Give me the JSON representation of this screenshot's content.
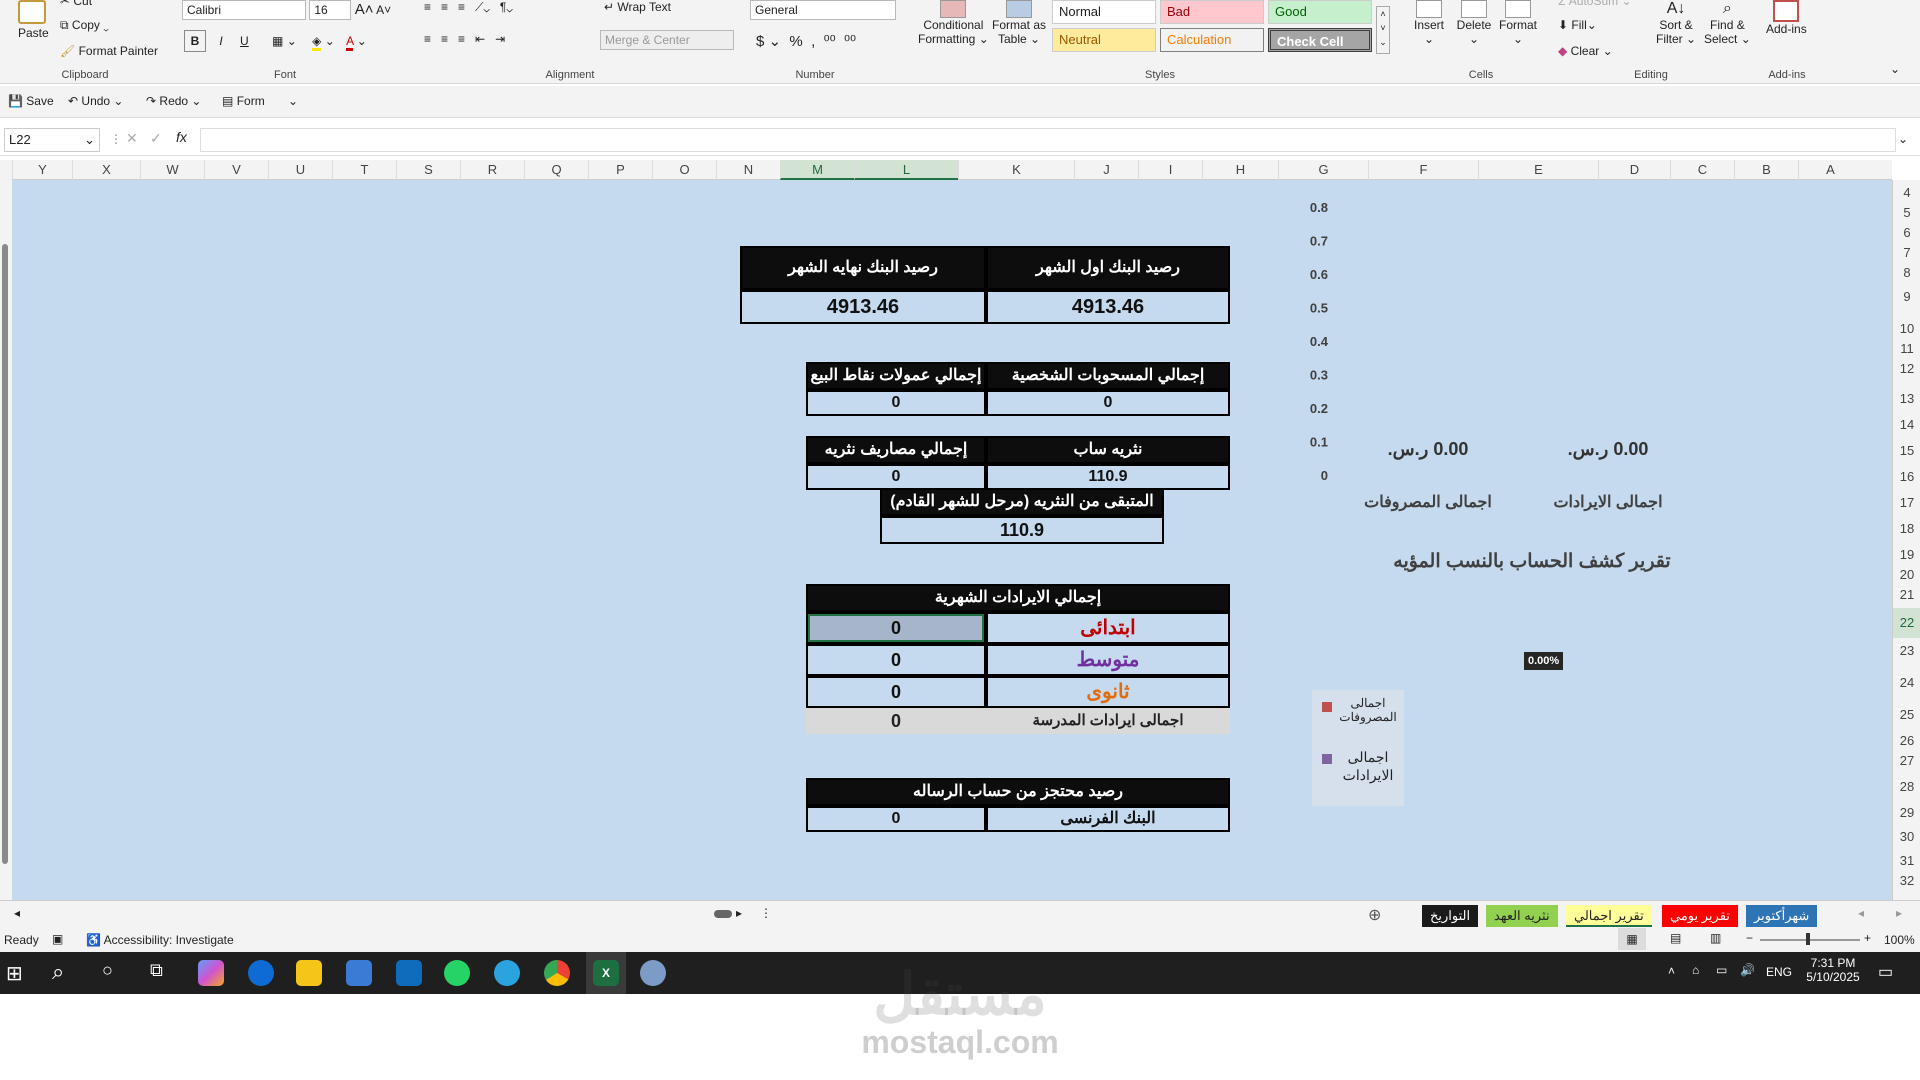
{
  "ribbon": {
    "clipboard": {
      "paste": "Paste",
      "cut": "Cut",
      "copy": "Copy",
      "format_painter": "Format Painter",
      "label": "Clipboard"
    },
    "font": {
      "name": "Calibri",
      "size": "16",
      "bold": "B",
      "italic": "I",
      "underline": "U",
      "label": "Font"
    },
    "alignment": {
      "wrap_text": "Wrap Text",
      "merge_center": "Merge & Center",
      "label": "Alignment"
    },
    "number": {
      "format": "General",
      "label": "Number"
    },
    "styles": {
      "conditional": "Conditional",
      "conditional2": "Formatting",
      "format_as": "Format as",
      "format_as2": "Table",
      "normal": "Normal",
      "bad": "Bad",
      "good": "Good",
      "neutral": "Neutral",
      "calculation": "Calculation",
      "check_cell": "Check Cell",
      "label": "Styles"
    },
    "cells": {
      "insert": "Insert",
      "delete": "Delete",
      "format": "Format",
      "label": "Cells"
    },
    "editing": {
      "autosum": "AutoSum",
      "fill": "Fill",
      "clear": "Clear",
      "sort": "Sort &",
      "sort2": "Filter",
      "find": "Find &",
      "find2": "Select",
      "label": "Editing"
    },
    "addins": {
      "addins": "Add-ins",
      "label": "Add-ins"
    }
  },
  "qat": {
    "save": "Save",
    "undo": "Undo",
    "redo": "Redo",
    "form": "Form"
  },
  "formula_bar": {
    "name_box": "L22",
    "fx": "fx",
    "formula": ""
  },
  "columns": [
    "Y",
    "X",
    "W",
    "V",
    "U",
    "T",
    "S",
    "R",
    "Q",
    "P",
    "O",
    "N",
    "M",
    "L",
    "K",
    "J",
    "I",
    "H",
    "G",
    "F",
    "E",
    "D",
    "C",
    "B",
    "A"
  ],
  "rows": [
    "4",
    "5",
    "6",
    "7",
    "8",
    "9",
    "10",
    "11",
    "12",
    "13",
    "14",
    "15",
    "16",
    "17",
    "18",
    "19",
    "20",
    "21",
    "22",
    "23",
    "24",
    "25",
    "26",
    "27",
    "28",
    "29",
    "30",
    "31",
    "32"
  ],
  "sheet": {
    "bank_start_label": "رصيد البنك اول الشهر",
    "bank_end_label": "رصيد البنك نهايه الشهر",
    "bank_start_value": "4913.46",
    "bank_end_value": "4913.46",
    "personal_withdrawals_label": "إجمالي المسحوبات الشخصية",
    "pos_commissions_label": "إجمالي عمولات نقاط البيع",
    "personal_withdrawals_value": "0",
    "pos_commissions_value": "0",
    "tharwa_sab_label": "نثريه ساب",
    "tharwa_expenses_label": "إجمالي مصاريف نثريه ساب",
    "tharwa_sab_value": "110.9",
    "tharwa_expenses_value": "0",
    "tharwa_remaining_label": "المتبقى من النثريه (مرحل للشهر القادم)",
    "tharwa_remaining_value": "110.9",
    "monthly_revenue_label": "إجمالي الايرادات الشهرية",
    "primary_label": "ابتدائى",
    "primary_value": "0",
    "middle_label": "متوسط",
    "middle_value": "0",
    "secondary_label": "ثانوى",
    "secondary_value": "0",
    "school_total_label": "اجمالى ايرادات المدرسة",
    "school_total_value": "0",
    "reserved_label": "رصيد محتجز من حساب الرساله",
    "french_bank_label": "البنك الفرنسى",
    "french_bank_value": "0"
  },
  "chart_data": [
    {
      "type": "bar",
      "categories": [
        "اجمالى الايرادات",
        "اجمالى المصروفات"
      ],
      "values": [
        0,
        0
      ],
      "data_labels": [
        "0.00 ر.س.",
        "0.00 ر.س."
      ],
      "y_ticks": [
        "0.8",
        "0.7",
        "0.6",
        "0.5",
        "0.4",
        "0.3",
        "0.2",
        "0.1",
        "0"
      ],
      "ylim": [
        0,
        0.8
      ]
    },
    {
      "type": "pie",
      "title": "تقرير كشف الحساب بالنسب المؤيه",
      "data_label": "0.00%",
      "legend": [
        "اجمالى المصروفات",
        "اجمالى الايرادات"
      ],
      "legend_colors": [
        "#c0504d",
        "#8064a2"
      ]
    }
  ],
  "tabs": [
    "شهرأكتوبر",
    "تقرير يومي",
    "تقرير اجمالي",
    "نثريه العهد",
    "التواريخ"
  ],
  "status": {
    "ready": "Ready",
    "accessibility": "Accessibility: Investigate",
    "zoom": "100%"
  },
  "taskbar": {
    "time": "7:31 PM",
    "date": "5/10/2025",
    "lang": "ENG"
  },
  "watermark": {
    "arabic": "مستقل",
    "latin": "mostaql.com"
  },
  "colors": {
    "sheet_bg": "#c5d9ef",
    "header_bg": "#0d0d0d",
    "primary": "#c00000",
    "middle": "#7030a0",
    "secondary": "#e36c09"
  }
}
